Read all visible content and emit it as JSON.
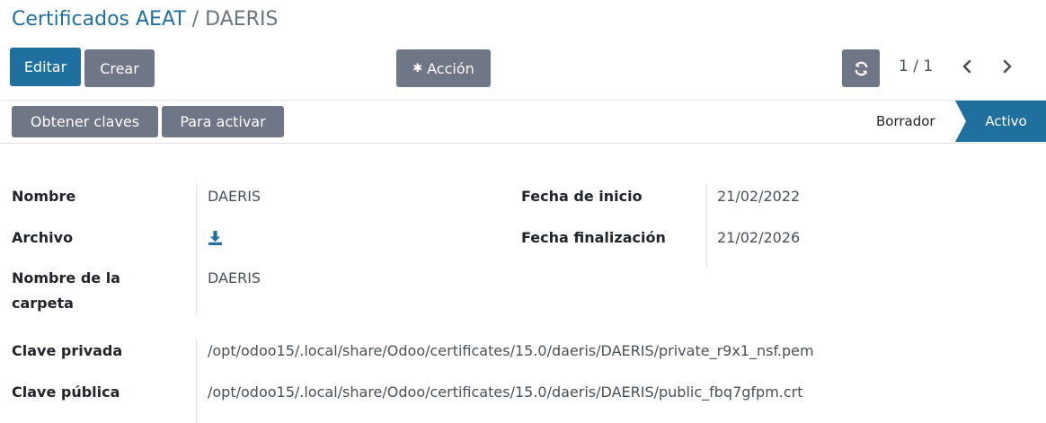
{
  "breadcrumb": {
    "parent": "Certificados AEAT",
    "separator": "/",
    "current": "DAERIS"
  },
  "toolbar": {
    "edit_label": "Editar",
    "create_label": "Crear",
    "action_label": "Acción",
    "pager": "1 / 1"
  },
  "statusbar": {
    "obtain_keys_label": "Obtener claves",
    "to_activate_label": "Para activar",
    "stages": [
      "Borrador",
      "Activo"
    ],
    "active_stage": "Activo"
  },
  "form": {
    "name_label": "Nombre",
    "name_value": "DAERIS",
    "file_label": "Archivo",
    "folder_label": "Nombre de la carpeta",
    "folder_value": "DAERIS",
    "start_label": "Fecha de inicio",
    "start_value": "21/02/2022",
    "end_label": "Fecha finalización",
    "end_value": "21/02/2026",
    "private_key_label": "Clave privada",
    "private_key_value": "/opt/odoo15/.local/share/Odoo/certificates/15.0/daeris/DAERIS/private_r9x1_nsf.pem",
    "public_key_label": "Clave pública",
    "public_key_value": "/opt/odoo15/.local/share/Odoo/certificates/15.0/daeris/DAERIS/public_fbq7gfpm.crt"
  },
  "icons": {
    "action": "gear-icon",
    "reload": "refresh-icon",
    "prev": "chevron-left-icon",
    "next": "chevron-right-icon",
    "download": "download-icon"
  },
  "colors": {
    "primary": "#1f6f9f",
    "secondary": "#6f7686"
  }
}
